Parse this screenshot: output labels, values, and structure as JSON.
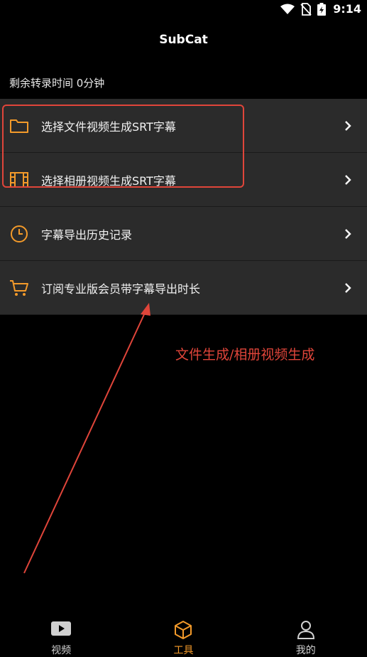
{
  "status": {
    "time": "9:14"
  },
  "app": {
    "title": "SubCat"
  },
  "remaining_text": "剩余转录时间 0分钟",
  "menu": [
    {
      "label": "选择文件视频生成SRT字幕",
      "icon": "folder-icon"
    },
    {
      "label": "选择相册视频生成SRT字幕",
      "icon": "film-icon"
    },
    {
      "label": "字幕导出历史记录",
      "icon": "clock-icon"
    },
    {
      "label": "订阅专业版会员带字幕导出时长",
      "icon": "cart-icon"
    }
  ],
  "annotation": "文件生成/相册视频生成",
  "nav": [
    {
      "label": "视频",
      "icon": "video-icon"
    },
    {
      "label": "工具",
      "icon": "cube-icon",
      "active": true
    },
    {
      "label": "我的",
      "icon": "person-icon"
    }
  ],
  "colors": {
    "accent": "#f39a2a",
    "annotation": "#e0453a",
    "row_bg": "#2b2b2b"
  }
}
